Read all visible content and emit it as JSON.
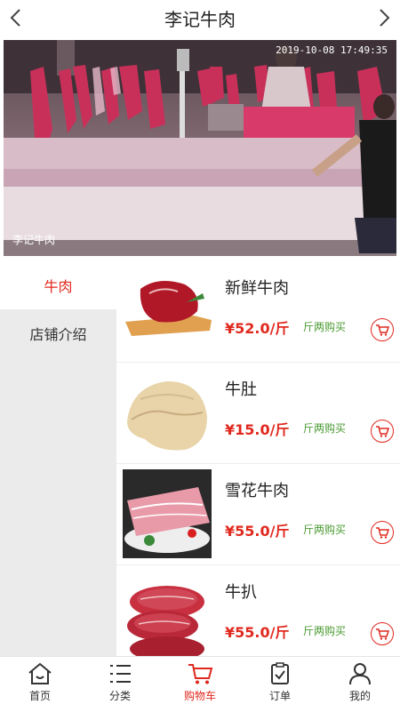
{
  "header": {
    "title": "李记牛肉"
  },
  "banner": {
    "timestamp": "2019-10-08 17:49:35",
    "watermark": "李记牛肉"
  },
  "sidebar": {
    "categories": [
      {
        "label": "牛肉",
        "active": true
      },
      {
        "label": "店铺介绍",
        "active": false
      }
    ]
  },
  "products": [
    {
      "name": "新鲜牛肉",
      "price": "¥52.0/斤",
      "unit_link": "斤两购买"
    },
    {
      "name": "牛肚",
      "price": "¥15.0/斤",
      "unit_link": "斤两购买"
    },
    {
      "name": "雪花牛肉",
      "price": "¥55.0/斤",
      "unit_link": "斤两购买"
    },
    {
      "name": "牛扒",
      "price": "¥55.0/斤",
      "unit_link": "斤两购买"
    }
  ],
  "tabbar": {
    "items": [
      {
        "label": "首页",
        "icon": "home-icon",
        "active": false
      },
      {
        "label": "分类",
        "icon": "list-icon",
        "active": false
      },
      {
        "label": "购物车",
        "icon": "cart-icon",
        "active": true
      },
      {
        "label": "订单",
        "icon": "order-icon",
        "active": false
      },
      {
        "label": "我的",
        "icon": "user-icon",
        "active": false
      }
    ]
  },
  "colors": {
    "accent": "#e0281e",
    "unit_link": "#4a9a32",
    "sidebar_bg": "#ebebeb"
  }
}
